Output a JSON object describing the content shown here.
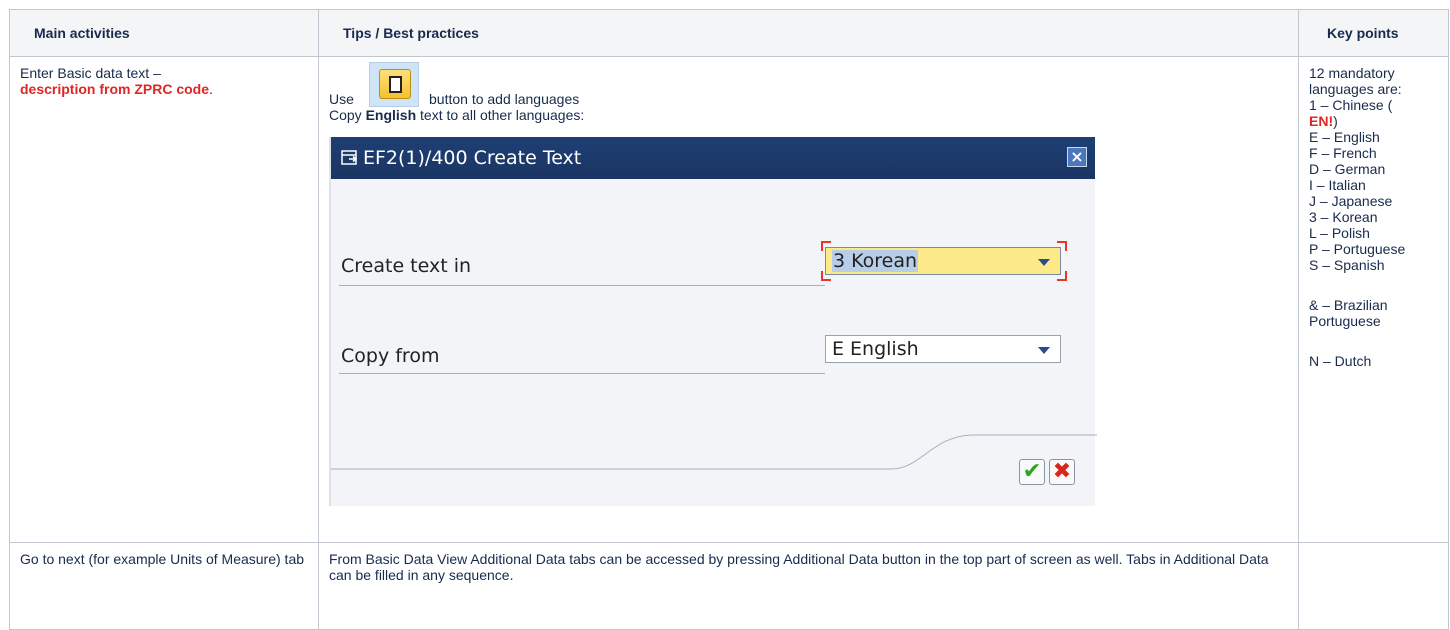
{
  "table": {
    "headers": [
      "Main activities",
      "Tips / Best practices",
      "Key points"
    ],
    "row1": {
      "activity_prefix": "Enter Basic data text –",
      "activity_highlight": "description from ZPRC code",
      "activity_suffix": ".",
      "tip_use": "Use",
      "tip_use_rest": "button to add languages",
      "tip_copy_prefix": "Copy",
      "tip_copy_bold": "English",
      "tip_copy_suffix": "text to all other languages:"
    },
    "row2": {
      "activity": "Go to next (for example Units of Measure) tab",
      "tip": "From Basic Data View Additional Data tabs can be accessed by pressing Additional Data button in the top part of screen as well. Tabs in Additional Data can be filled in any sequence.",
      "keypoints": ""
    }
  },
  "keypoints": {
    "intro_1": "12 mandatory",
    "intro_2": "languages are:",
    "chinese_prefix": "1 – Chinese (",
    "chinese_en": "EN!",
    "chinese_suffix": ")",
    "languages": [
      "E – English",
      "F – French",
      "D – German",
      "I – Italian",
      "J – Japanese",
      "3 – Korean",
      "L – Polish",
      "P – Portuguese",
      "S – Spanish"
    ],
    "brazilian_1": "& – Brazilian",
    "brazilian_2": "Portuguese",
    "dutch": "N – Dutch"
  },
  "dialog": {
    "title": "EF2(1)/400 Create Text",
    "field1_label": "Create text in",
    "field1_value": "3 Korean",
    "field2_label": "Copy from",
    "field2_value": "E English"
  },
  "colors": {
    "highlight_red": "#e12525",
    "dialog_title_bg": "#1e3f74",
    "active_field_bg": "#fce98a"
  }
}
